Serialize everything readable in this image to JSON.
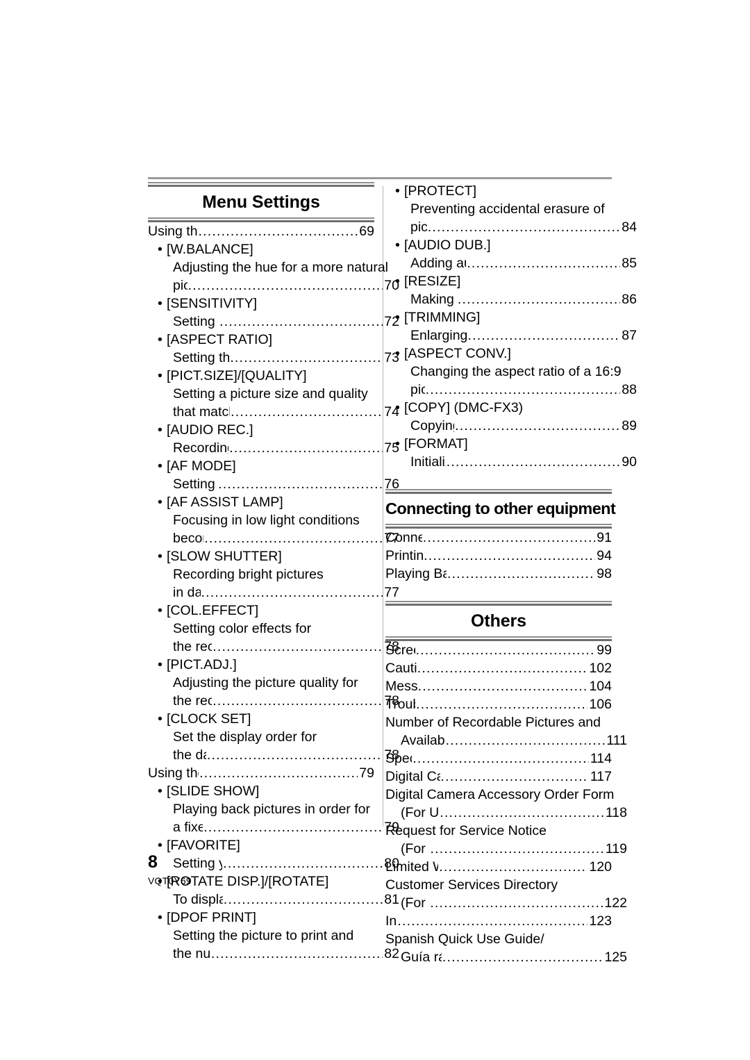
{
  "document": {
    "page_number": "8",
    "document_code": "VQT0Y69"
  },
  "left_column": {
    "section": {
      "title": "Menu Settings"
    },
    "entries": [
      {
        "type": "top",
        "text": "Using the [REC] Mode Menu",
        "page": "69"
      },
      {
        "type": "bullet",
        "text": "[W.BALANCE]"
      },
      {
        "type": "desc",
        "text": "Adjusting the hue for a more natural"
      },
      {
        "type": "desc-page",
        "text": "picture",
        "page": "70"
      },
      {
        "type": "bullet",
        "text": "[SENSITIVITY]"
      },
      {
        "type": "desc-page",
        "text": "Setting the light sensitivity",
        "page": "72"
      },
      {
        "type": "bullet",
        "text": "[ASPECT RATIO]"
      },
      {
        "type": "desc-page",
        "text": "Setting the aspect ratio of pictures",
        "page": "73"
      },
      {
        "type": "bullet",
        "text": "[PICT.SIZE]/[QUALITY]"
      },
      {
        "type": "desc",
        "text": "Setting a picture size and quality"
      },
      {
        "type": "desc-page",
        "text": "that match your use of the pictures",
        "page": "74"
      },
      {
        "type": "bullet",
        "text": "[AUDIO REC.]"
      },
      {
        "type": "desc-page",
        "text": "Recording still pictures with audio",
        "page": "75"
      },
      {
        "type": "bullet",
        "text": "[AF MODE]"
      },
      {
        "type": "desc-page",
        "text": "Setting the focus method",
        "page": "76"
      },
      {
        "type": "bullet",
        "text": "[AF ASSIST LAMP]"
      },
      {
        "type": "desc",
        "text": "Focusing in low light conditions"
      },
      {
        "type": "desc-page",
        "text": "becomes easier",
        "page": "77"
      },
      {
        "type": "bullet",
        "text": "[SLOW SHUTTER]"
      },
      {
        "type": "desc",
        "text": "Recording bright pictures"
      },
      {
        "type": "desc-page",
        "text": "in dark places",
        "page": "77"
      },
      {
        "type": "bullet",
        "text": "[COL.EFFECT]"
      },
      {
        "type": "desc",
        "text": "Setting color effects for"
      },
      {
        "type": "desc-page",
        "text": "the recorded pictures",
        "page": "78"
      },
      {
        "type": "bullet",
        "text": "[PICT.ADJ.]"
      },
      {
        "type": "desc",
        "text": "Adjusting the picture quality for"
      },
      {
        "type": "desc-page",
        "text": "the recorded pictures",
        "page": "78"
      },
      {
        "type": "bullet",
        "text": "[CLOCK SET]"
      },
      {
        "type": "desc",
        "text": "Set the display order for"
      },
      {
        "type": "desc-page",
        "text": "the date and time",
        "page": "78"
      },
      {
        "type": "top",
        "text": "Using the [PLAY] mode menu",
        "page": "79"
      },
      {
        "type": "bullet",
        "text": "[SLIDE SHOW]"
      },
      {
        "type": "desc",
        "text": "Playing back pictures in order for"
      },
      {
        "type": "desc-page",
        "text": "a fixed duration",
        "page": "79"
      },
      {
        "type": "bullet",
        "text": "[FAVORITE]"
      },
      {
        "type": "desc-page",
        "text": "Setting your favorite pictures",
        "page": "80"
      },
      {
        "type": "bullet",
        "text": "[ROTATE DISP.]/[ROTATE]"
      },
      {
        "type": "desc-page",
        "text": "To display the picture rotated",
        "page": "81"
      },
      {
        "type": "bullet",
        "text": "[DPOF PRINT]"
      },
      {
        "type": "desc",
        "text": "Setting the picture to print and"
      },
      {
        "type": "desc-page",
        "text": "the number of prints",
        "page": "82"
      }
    ]
  },
  "right_column": {
    "menu_settings_continued": [
      {
        "type": "bullet",
        "text": "[PROTECT]"
      },
      {
        "type": "desc",
        "text": "Preventing accidental erasure of"
      },
      {
        "type": "desc-page",
        "text": "pictures",
        "page": "84"
      },
      {
        "type": "bullet",
        "text": "[AUDIO DUB.]"
      },
      {
        "type": "desc-page",
        "text": "Adding audio after taking pictures",
        "page": "85"
      },
      {
        "type": "bullet",
        "text": "[RESIZE]"
      },
      {
        "type": "desc-page",
        "text": "Making the picture smaller",
        "page": "86"
      },
      {
        "type": "bullet",
        "text": "[TRIMMING]"
      },
      {
        "type": "desc-page",
        "text": "Enlarging a picture and trimming it",
        "page": "87"
      },
      {
        "type": "bullet",
        "text": "[ASPECT CONV.]"
      },
      {
        "type": "desc",
        "text": "Changing the aspect ratio of a 16:9"
      },
      {
        "type": "desc-page",
        "text": "picture",
        "page": "88"
      },
      {
        "type": "bullet",
        "text": "[COPY] (DMC-FX3)"
      },
      {
        "type": "desc-page",
        "text": "Copying the picture data",
        "page": "89"
      },
      {
        "type": "bullet",
        "text": "[FORMAT]"
      },
      {
        "type": "desc-page",
        "text": "Initializing the card",
        "page": "90"
      }
    ],
    "section_connecting": {
      "title": "Connecting to other equipment",
      "entries": [
        {
          "type": "top",
          "text": "Connecting to a PC",
          "page": "91"
        },
        {
          "type": "top",
          "text": "Printing the Pictures",
          "page": "94"
        },
        {
          "type": "top",
          "text": "Playing Back Pictures on a TV Screen",
          "page": "98"
        }
      ]
    },
    "section_others": {
      "title": "Others",
      "entries": [
        {
          "type": "top",
          "text": "Screen Display",
          "page": "99"
        },
        {
          "type": "top",
          "text": "Cautions for Use",
          "page": "102"
        },
        {
          "type": "top",
          "text": "Message Display",
          "page": "104"
        },
        {
          "type": "top",
          "text": "Troubleshooting",
          "page": "106"
        },
        {
          "type": "top-nopage",
          "text": "Number of Recordable Pictures and"
        },
        {
          "type": "cont-page",
          "text": "Available Recording Time",
          "page": "111"
        },
        {
          "type": "top",
          "text": "Specifications",
          "page": "114"
        },
        {
          "type": "top",
          "text": "Digital Camera Accessory System",
          "page": "117"
        },
        {
          "type": "top-nopage",
          "text": "Digital Camera Accessory Order Form"
        },
        {
          "type": "cont-page",
          "text": "(For USA Customers)",
          "page": "118"
        },
        {
          "type": "top-nopage",
          "text": "Request for Service Notice"
        },
        {
          "type": "cont-page",
          "text": "(For USA Only)",
          "page": "119"
        },
        {
          "type": "top",
          "text": "Limited Warranty (For USA Only)",
          "page": "120"
        },
        {
          "type": "top-nopage",
          "text": "Customer Services Directory"
        },
        {
          "type": "cont-page",
          "text": "(For USA Only)",
          "page": "122"
        },
        {
          "type": "top",
          "text": "Index",
          "page": "123"
        },
        {
          "type": "top-nopage",
          "text": "Spanish Quick Use Guide/"
        },
        {
          "type": "cont-page",
          "text": "Guía rápida en español",
          "page": "125"
        }
      ]
    }
  }
}
